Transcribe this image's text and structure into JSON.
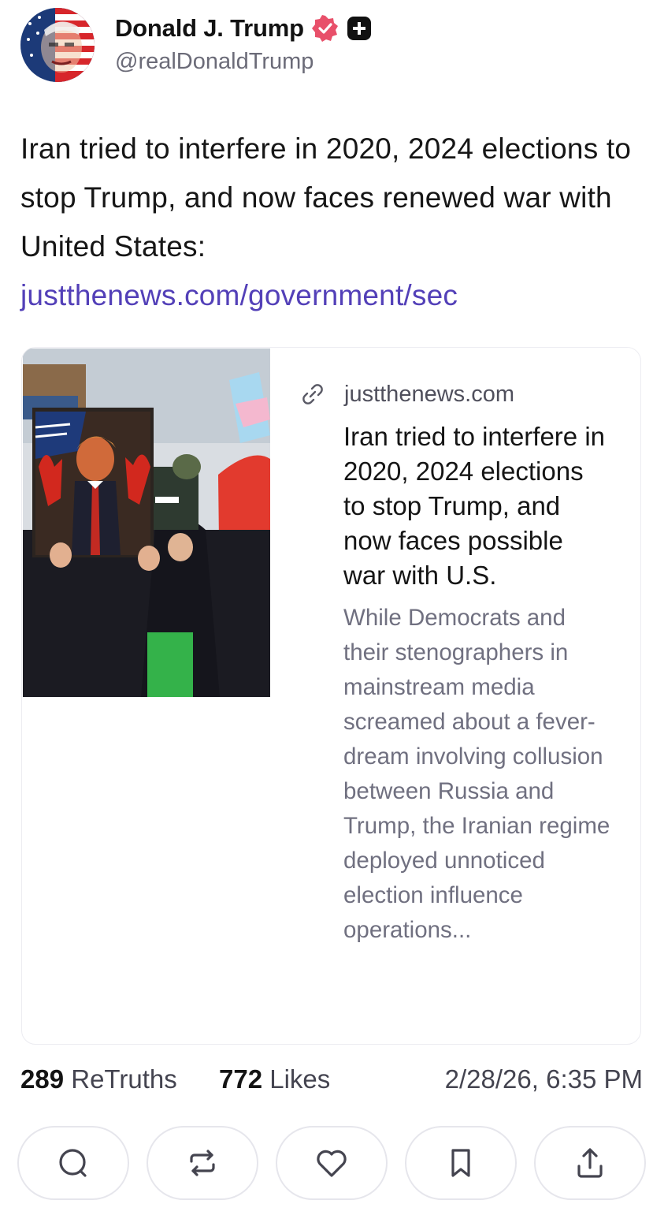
{
  "author": {
    "display_name": "Donald J. Trump",
    "handle": "@realDonaldTrump",
    "avatar_icon": "avatar-flag-portrait",
    "verified_color": "#e8506a"
  },
  "post": {
    "text": "Iran tried to interfere in 2020, 2024 elections to stop Trump, and now faces renewed war with United States:",
    "link_text": "justthenews.com/government/sec",
    "link_color": "#5340b8"
  },
  "link_card": {
    "domain": "justthenews.com",
    "title": "Iran tried to interfere in 2020, 2024 elections to stop Trump, and now faces possible war with U.S.",
    "description": "While Democrats and their stenographers in mainstream media screamed about a fever-dream involving collusion between Russia and Trump, the Iranian regime deployed unnoticed election influence operations...",
    "image_icon": "protest-photo"
  },
  "stats": {
    "retruths_count": "289",
    "retruths_label": "ReTruths",
    "likes_count": "772",
    "likes_label": "Likes",
    "timestamp": "2/28/26, 6:35 PM"
  },
  "actions": [
    {
      "name": "reply",
      "icon": "comment-icon"
    },
    {
      "name": "retruth",
      "icon": "repost-icon"
    },
    {
      "name": "like",
      "icon": "heart-icon"
    },
    {
      "name": "bookmark",
      "icon": "bookmark-icon"
    },
    {
      "name": "share",
      "icon": "share-icon"
    }
  ]
}
